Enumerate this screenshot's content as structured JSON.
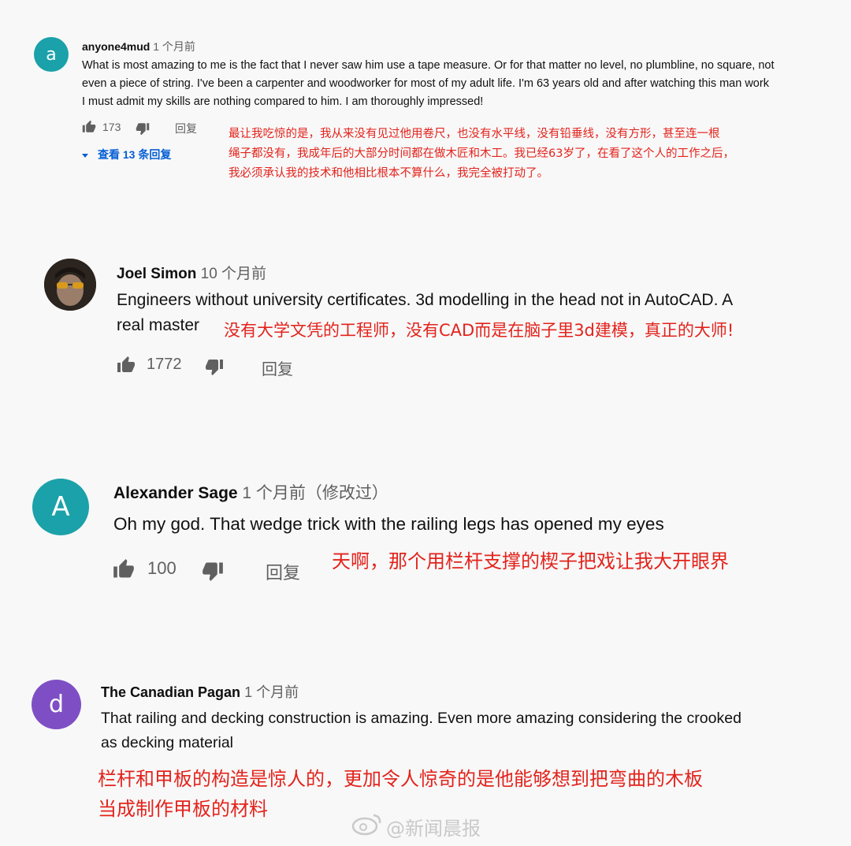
{
  "comments": [
    {
      "avatar_letter": "a",
      "avatar_color": "#1ba1a9",
      "author": "anyone4mud",
      "time": "1 个月前",
      "lines": [
        "What is most amazing to me is the fact that I never saw him use a tape measure.  Or for that matter no level, no plumbline, no square, not",
        "even a piece of string.  I've been a carpenter and woodworker for most of my adult life.  I'm 63 years old and after watching this man work",
        "I must admit my skills are nothing compared to him.  I am thoroughly impressed!"
      ],
      "likes": "173",
      "reply_label": "回复",
      "view_replies": "查看 13 条回复",
      "translation": [
        "最让我吃惊的是，我从来没有见过他用卷尺，也没有水平线，没有铅垂线，没有方形，甚至连一根",
        "绳子都没有，我成年后的大部分时间都在做木匠和木工。我已经63岁了，在看了这个人的工作之后，",
        "我必须承认我的技术和他相比根本不算什么，我完全被打动了。"
      ]
    },
    {
      "avatar_letter": "",
      "avatar_color": "#3a3028",
      "author": "Joel Simon",
      "time": "10 个月前",
      "lines": [
        "Engineers without university certificates. 3d modelling in the head not in AutoCAD. A",
        "real master"
      ],
      "likes": "1772",
      "reply_label": "回复",
      "translation": [
        "没有大学文凭的工程师，没有CAD而是在脑子里3d建模，真正的大师!"
      ]
    },
    {
      "avatar_letter": "A",
      "avatar_color": "#1ba1a9",
      "author": "Alexander Sage",
      "time": "1 个月前（修改过）",
      "lines": [
        "Oh my god. That wedge trick with the railing legs has opened my eyes"
      ],
      "likes": "100",
      "reply_label": "回复",
      "translation": [
        "天啊，那个用栏杆支撑的楔子把戏让我大开眼界"
      ]
    },
    {
      "avatar_letter": "d",
      "avatar_color": "#7e4fc4",
      "author": "The Canadian Pagan",
      "time": "1 个月前",
      "lines": [
        "That railing and decking construction is amazing. Even more amazing considering the crooked",
        "as decking material"
      ],
      "translation": [
        "栏杆和甲板的构造是惊人的，更加令人惊奇的是他能够想到把弯曲的木板",
        "当成制作甲板的材料"
      ]
    }
  ],
  "watermark": "@新闻晨报",
  "colors": {
    "accent": "#065fd4",
    "annotation": "#e3231c",
    "background": "#f8f8f8"
  },
  "icons": [
    "thumb-up-icon",
    "thumb-down-icon",
    "caret-down-icon",
    "weibo-icon"
  ]
}
